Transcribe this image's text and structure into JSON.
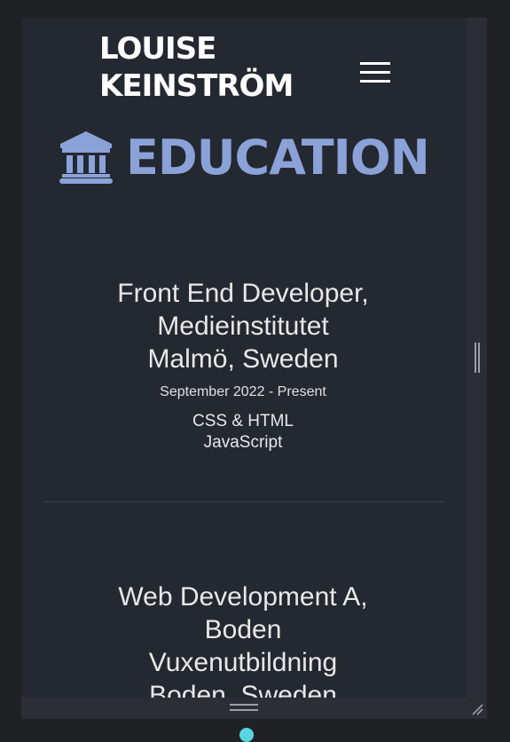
{
  "header": {
    "brand_line1": "LOUISE",
    "brand_line2": "KEINSTRÖM",
    "menu_icon": "hamburger-menu-icon"
  },
  "section": {
    "icon": "bank-building-icon",
    "title": "EDUCATION",
    "accent_color": "#8aa2d8"
  },
  "education": [
    {
      "title_line1": "Front End Developer,",
      "title_line2": "Medieinstitutet",
      "title_line3": "Malmö, Sweden",
      "date": "September 2022 - Present",
      "detail_line1": "CSS & HTML",
      "detail_line2": "JavaScript"
    },
    {
      "title_line1": "Web Development A,",
      "title_line2": "Boden",
      "title_line3": "Vuxenutbildning",
      "title_line4": "Boden, Sweden"
    }
  ]
}
